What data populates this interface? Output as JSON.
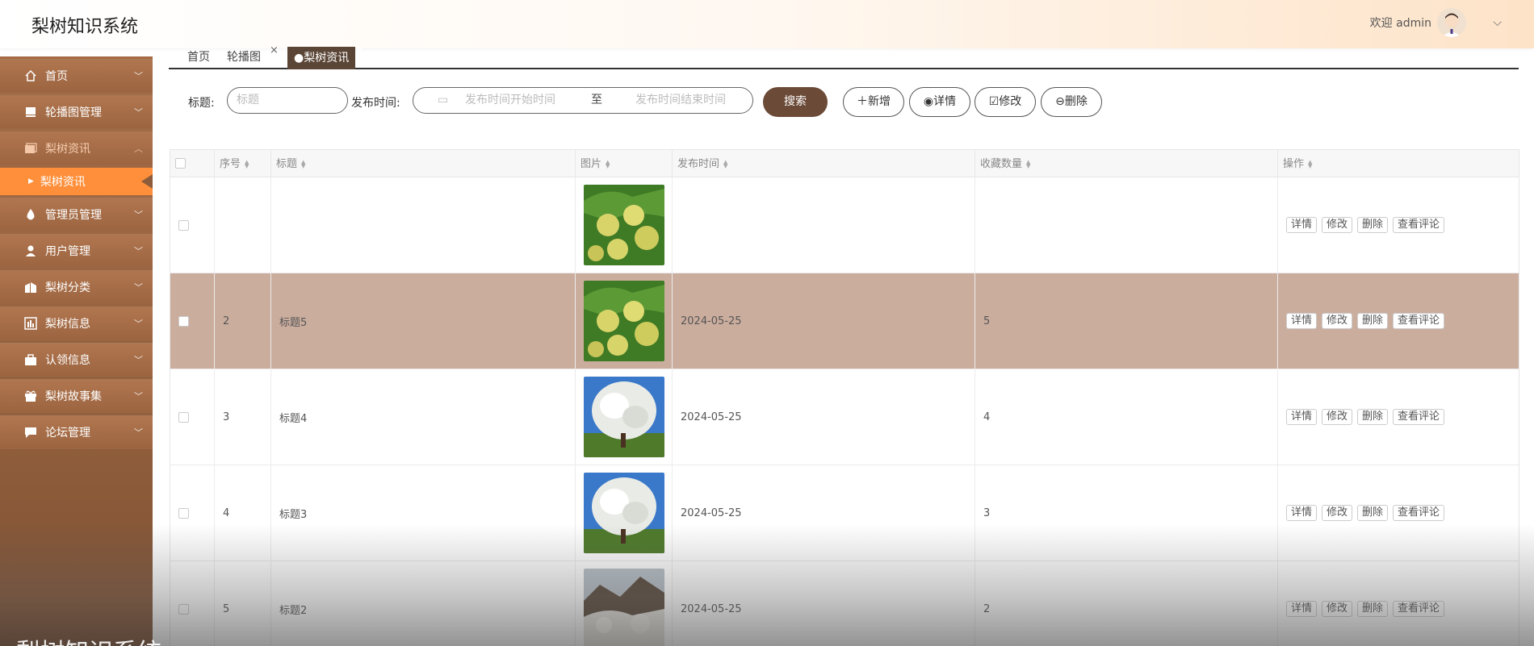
{
  "header": {
    "app_title": "梨树知识系统",
    "welcome": "欢迎 admin"
  },
  "sidebar": {
    "items": [
      {
        "label": "首页",
        "icon": "home-icon"
      },
      {
        "label": "轮播图管理",
        "icon": "image-icon"
      },
      {
        "label": "梨树资讯",
        "icon": "folder-icon",
        "expanded": true,
        "sub": "梨树资讯"
      },
      {
        "label": "管理员管理",
        "icon": "drop-icon"
      },
      {
        "label": "用户管理",
        "icon": "user-icon"
      },
      {
        "label": "梨树分类",
        "icon": "category-icon"
      },
      {
        "label": "梨树信息",
        "icon": "chart-icon"
      },
      {
        "label": "认领信息",
        "icon": "briefcase-icon"
      },
      {
        "label": "梨树故事集",
        "icon": "gift-icon"
      },
      {
        "label": "论坛管理",
        "icon": "chat-icon"
      }
    ]
  },
  "tabs": [
    {
      "label": "首页",
      "closable": false
    },
    {
      "label": "轮播图",
      "closable": true
    },
    {
      "label": "●梨树资讯",
      "closable": true,
      "active": true
    }
  ],
  "search": {
    "title_label": "标题:",
    "title_placeholder": "标题",
    "time_label": "发布时间:",
    "start_placeholder": "发布时间开始时间",
    "range_sep": "至",
    "end_placeholder": "发布时间结束时间",
    "search_btn": "搜索",
    "add_btn": "新增",
    "detail_btn": "详情",
    "edit_btn": "修改",
    "delete_btn": "删除"
  },
  "table": {
    "columns": [
      "序号",
      "标题",
      "图片",
      "发布时间",
      "收藏数量",
      "操作"
    ],
    "rows": [
      {
        "no": "",
        "title": "",
        "time": "",
        "fav": "",
        "image": "pear-fruit",
        "highlight": false
      },
      {
        "no": "2",
        "title": "标题5",
        "time": "2024-05-25",
        "fav": "5",
        "image": "pear-fruit",
        "highlight": true
      },
      {
        "no": "3",
        "title": "标题4",
        "time": "2024-05-25",
        "fav": "4",
        "image": "pear-tree",
        "highlight": false
      },
      {
        "no": "4",
        "title": "标题3",
        "time": "2024-05-25",
        "fav": "3",
        "image": "pear-tree",
        "highlight": false
      },
      {
        "no": "5",
        "title": "标题2",
        "time": "2024-05-25",
        "fav": "2",
        "image": "pear-mountain",
        "highlight": false
      }
    ],
    "ops": [
      "详情",
      "修改",
      "删除",
      "查看评论"
    ]
  },
  "footer": {
    "text": "梨树知识系统"
  },
  "colors": {
    "accent": "#6b4a37",
    "sidebar": "#9c6540",
    "active_sub": "#ff8f3a",
    "highlight_row": "#cbad9e"
  }
}
